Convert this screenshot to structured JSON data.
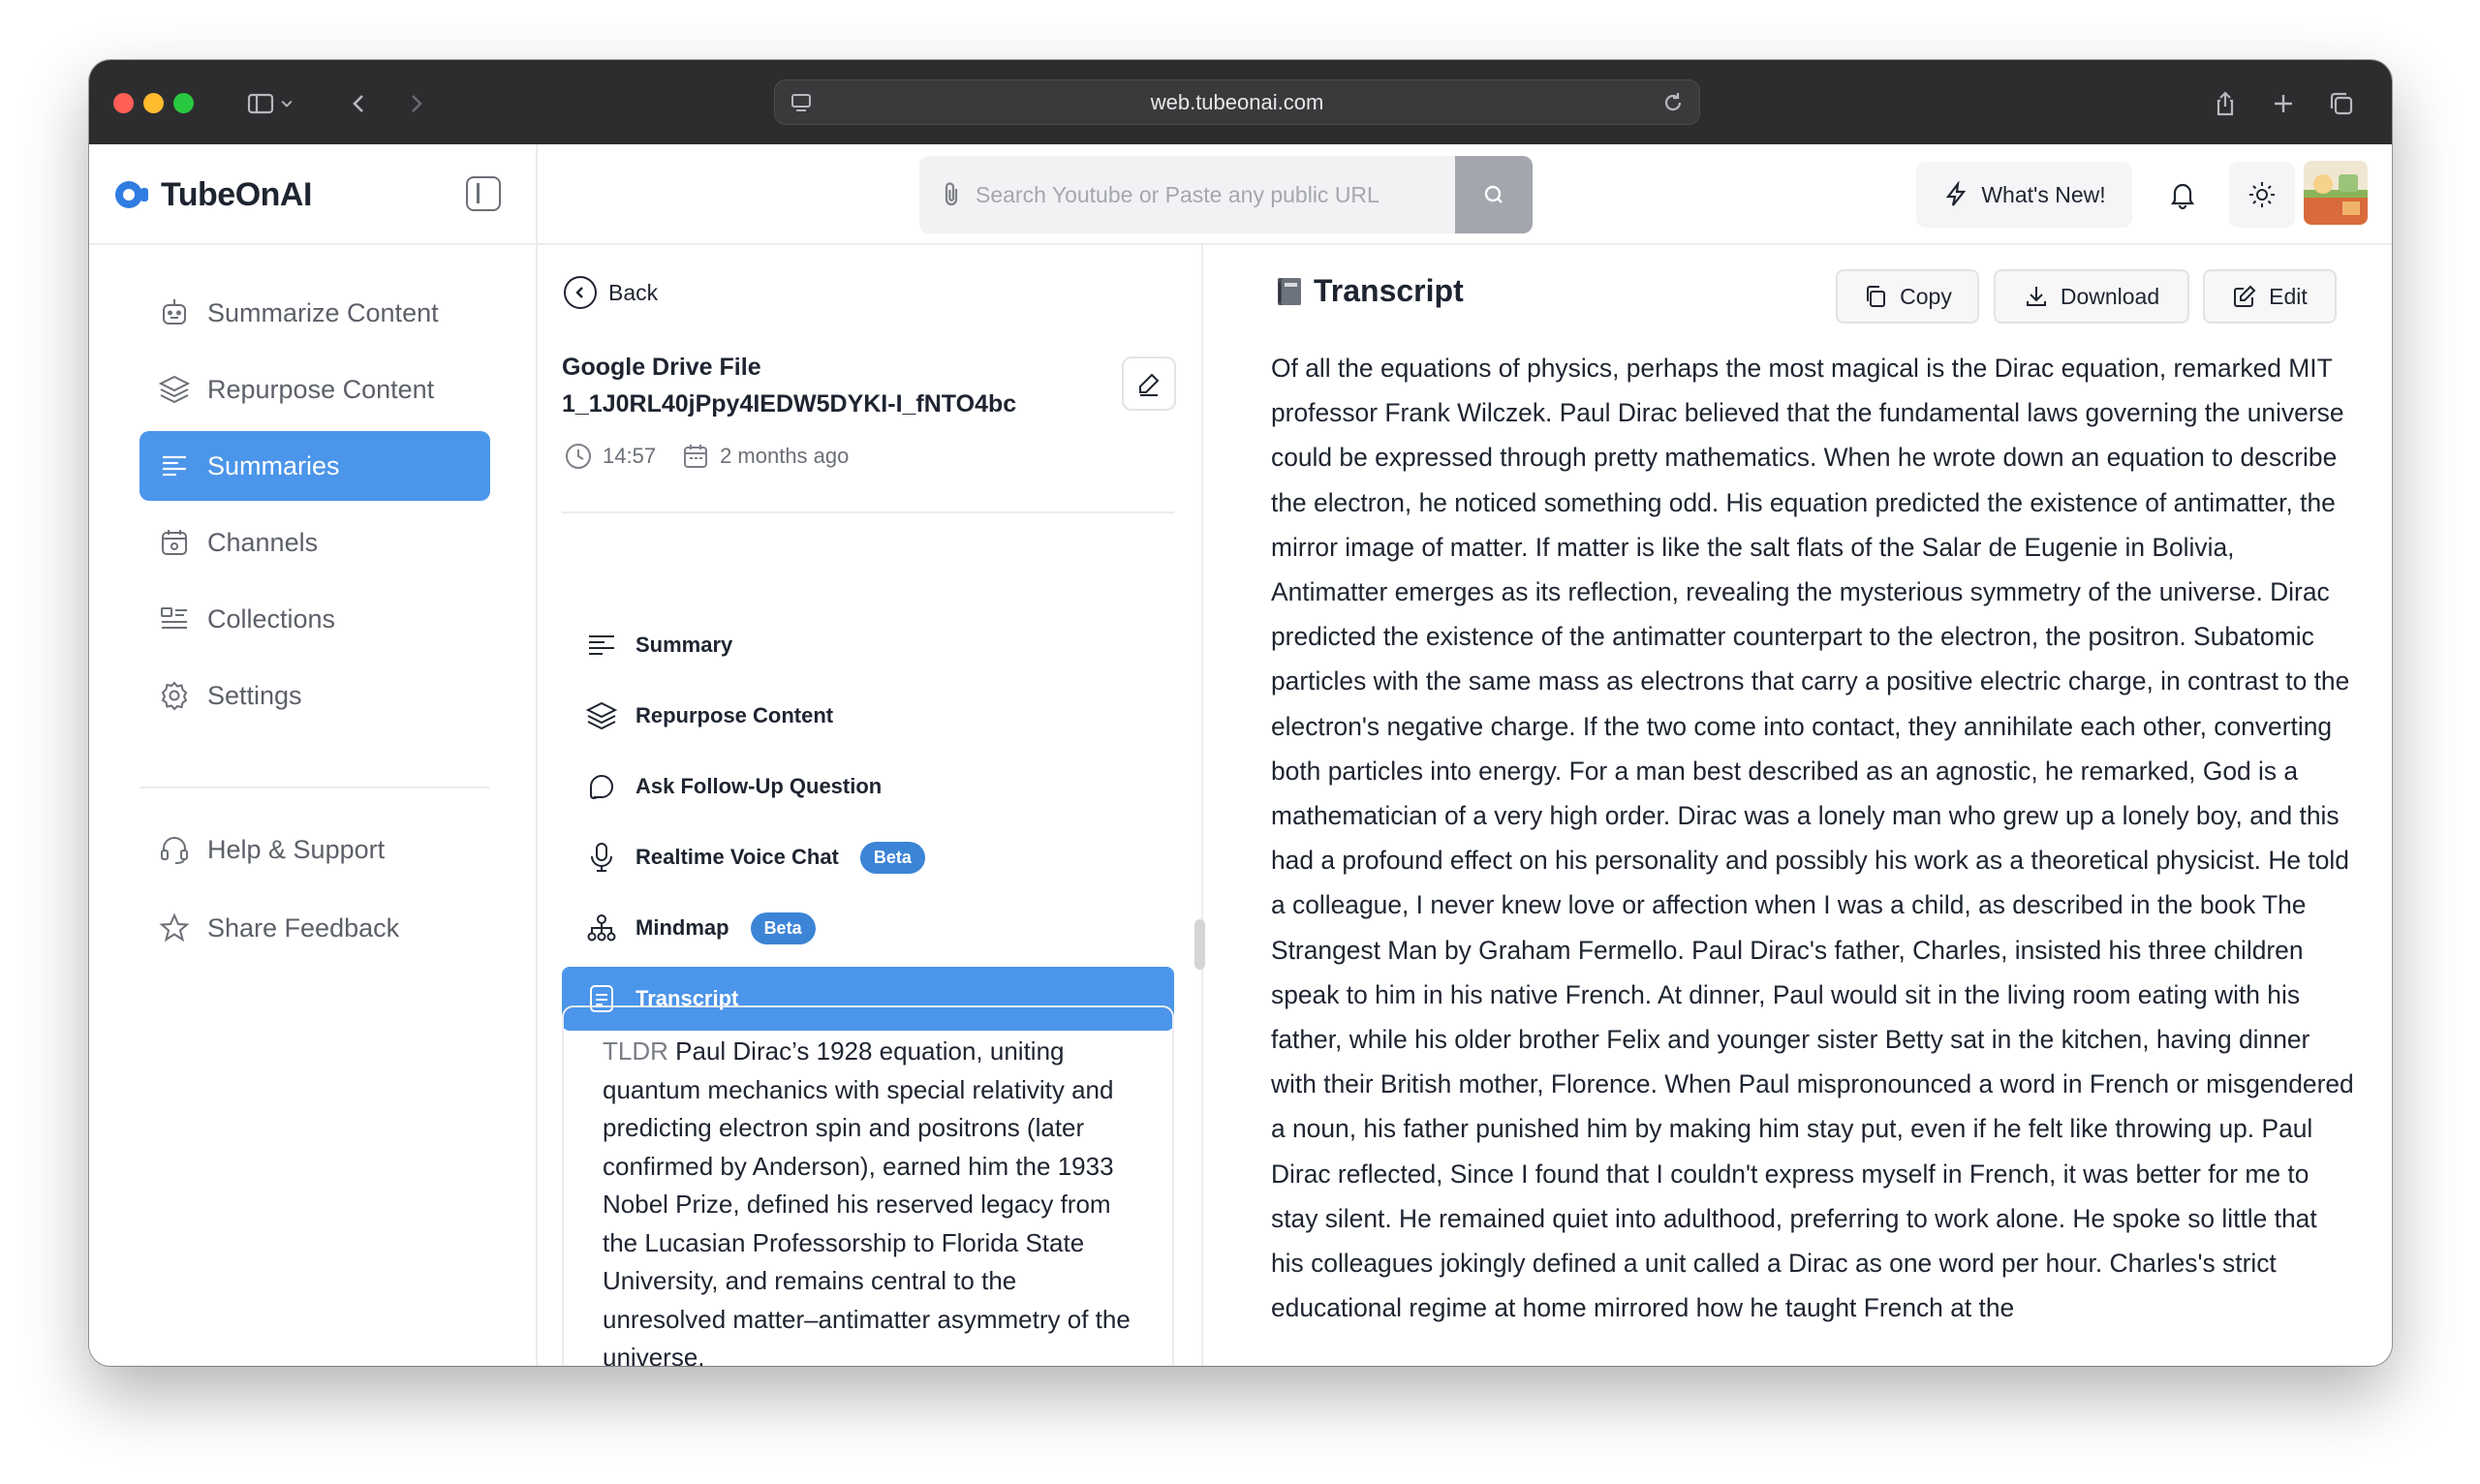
{
  "browser": {
    "url": "web.tubeonai.com",
    "traffic_colors": {
      "close": "#ff5f57",
      "minimize": "#febc2e",
      "maximize": "#28c840"
    }
  },
  "brand": {
    "name": "TubeOnAI",
    "accent": "#4b95ea"
  },
  "header": {
    "search_placeholder": "Search Youtube or Paste any public URL",
    "whats_new_label": "What's New!"
  },
  "sidebar": {
    "items": [
      {
        "label": "Summarize Content",
        "icon": "robot-icon"
      },
      {
        "label": "Repurpose Content",
        "icon": "layers-icon"
      },
      {
        "label": "Summaries",
        "icon": "lines-icon",
        "active": true
      },
      {
        "label": "Channels",
        "icon": "calendar-icon"
      },
      {
        "label": "Collections",
        "icon": "collection-icon"
      },
      {
        "label": "Settings",
        "icon": "gear-icon"
      }
    ],
    "footer": [
      {
        "label": "Help & Support",
        "icon": "headset-icon"
      },
      {
        "label": "Share Feedback",
        "icon": "star-icon"
      }
    ]
  },
  "detail": {
    "back_label": "Back",
    "file_title_line1": "Google Drive File",
    "file_title_line2": "1_1J0RL40jPpy4IEDW5DYKI-I_fNTO4bc",
    "duration": "14:57",
    "age": "2 months ago",
    "menu": [
      {
        "label": "Summary",
        "icon": "lines-icon"
      },
      {
        "label": "Repurpose Content",
        "icon": "layers-icon"
      },
      {
        "label": "Ask Follow-Up Question",
        "icon": "chat-icon"
      },
      {
        "label": "Realtime Voice Chat",
        "icon": "microphone-icon",
        "badge": "Beta"
      },
      {
        "label": "Mindmap",
        "icon": "mindmap-icon",
        "badge": "Beta"
      },
      {
        "label": "Transcript",
        "icon": "document-icon",
        "active": true
      }
    ],
    "tldr_label": "TLDR",
    "tldr_text": "Paul Dirac’s 1928 equation, uniting quantum mechanics with special relativity and predicting electron spin and positrons (later confirmed by Anderson), earned him the 1933 Nobel Prize, defined his reserved legacy from the Lucasian Professorship to Florida State University, and remains central to the unresolved matter–antimatter asymmetry of the universe."
  },
  "transcript": {
    "title": "Transcript",
    "buttons": {
      "copy": "Copy",
      "download": "Download",
      "edit": "Edit"
    },
    "text": "Of all the equations of physics, perhaps the most magical is the Dirac equation, remarked MIT professor Frank Wilczek. Paul Dirac believed that the fundamental laws governing the universe could be expressed through pretty mathematics. When he wrote down an equation to describe the electron, he noticed something odd. His equation predicted the existence of antimatter, the mirror image of matter. If matter is like the salt flats of the Salar de Eugenie in Bolivia, Antimatter emerges as its reflection, revealing the mysterious symmetry of the universe. Dirac predicted the existence of the antimatter counterpart to the electron, the positron. Subatomic particles with the same mass as electrons that carry a positive electric charge, in contrast to the electron's negative charge. If the two come into contact, they annihilate each other, converting both particles into energy. For a man best described as an agnostic, he remarked, God is a mathematician of a very high order. Dirac was a lonely man who grew up a lonely boy, and this had a profound effect on his personality and possibly his work as a theoretical physicist. He told a colleague, I never knew love or affection when I was a child, as described in the book The Strangest Man by Graham Fermello. Paul Dirac's father, Charles, insisted his three children speak to him in his native French. At dinner, Paul would sit in the living room eating with his father, while his older brother Felix and younger sister Betty sat in the kitchen, having dinner with their British mother, Florence. When Paul mispronounced a word in French or misgendered a noun, his father punished him by making him stay put, even if he felt like throwing up. Paul Dirac reflected, Since I found that I couldn't express myself in French, it was better for me to stay silent. He remained quiet into adulthood, preferring to work alone. He spoke so little that his colleagues jokingly defined a unit called a Dirac as one word per hour. Charles's strict educational regime at home mirrored how he taught French at the"
  }
}
